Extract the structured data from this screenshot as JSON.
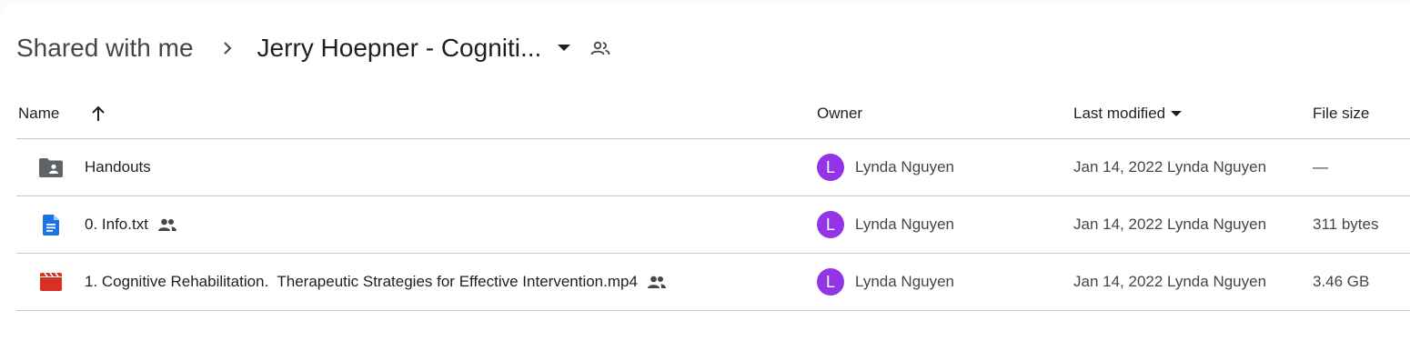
{
  "breadcrumb": {
    "root": "Shared with me",
    "separator_icon": "chevron-right-icon",
    "current": "Jerry Hoepner - Cogniti...",
    "caret_icon": "arrow-drop-down-icon",
    "shared_icon": "people-icon"
  },
  "table": {
    "columns": {
      "name": "Name",
      "owner": "Owner",
      "last_modified": "Last modified",
      "file_size": "File size"
    },
    "sort": {
      "column": "name",
      "direction": "ascending",
      "icon": "arrow-up-icon"
    },
    "rows": [
      {
        "icon": "shared-folder-icon",
        "name": "Handouts",
        "shared": false,
        "owner_initial": "L",
        "owner": "Lynda Nguyen",
        "modified": "Jan 14, 2022 Lynda Nguyen",
        "size": "—"
      },
      {
        "icon": "google-docs-icon",
        "name": "0. Info.txt",
        "shared": true,
        "owner_initial": "L",
        "owner": "Lynda Nguyen",
        "modified": "Jan 14, 2022 Lynda Nguyen",
        "size": "311 bytes"
      },
      {
        "icon": "video-file-icon",
        "name": "1. Cognitive Rehabilitation.  Therapeutic Strategies for Effective Intervention.mp4",
        "shared": true,
        "owner_initial": "L",
        "owner": "Lynda Nguyen",
        "modified": "Jan 14, 2022 Lynda Nguyen",
        "size": "3.46 GB"
      }
    ]
  },
  "colors": {
    "avatar": "#9334e6",
    "folder_icon": "#5f6368",
    "docs_icon": "#1a73e8",
    "video_icon": "#d93025",
    "divider": "#c7c7c7"
  }
}
